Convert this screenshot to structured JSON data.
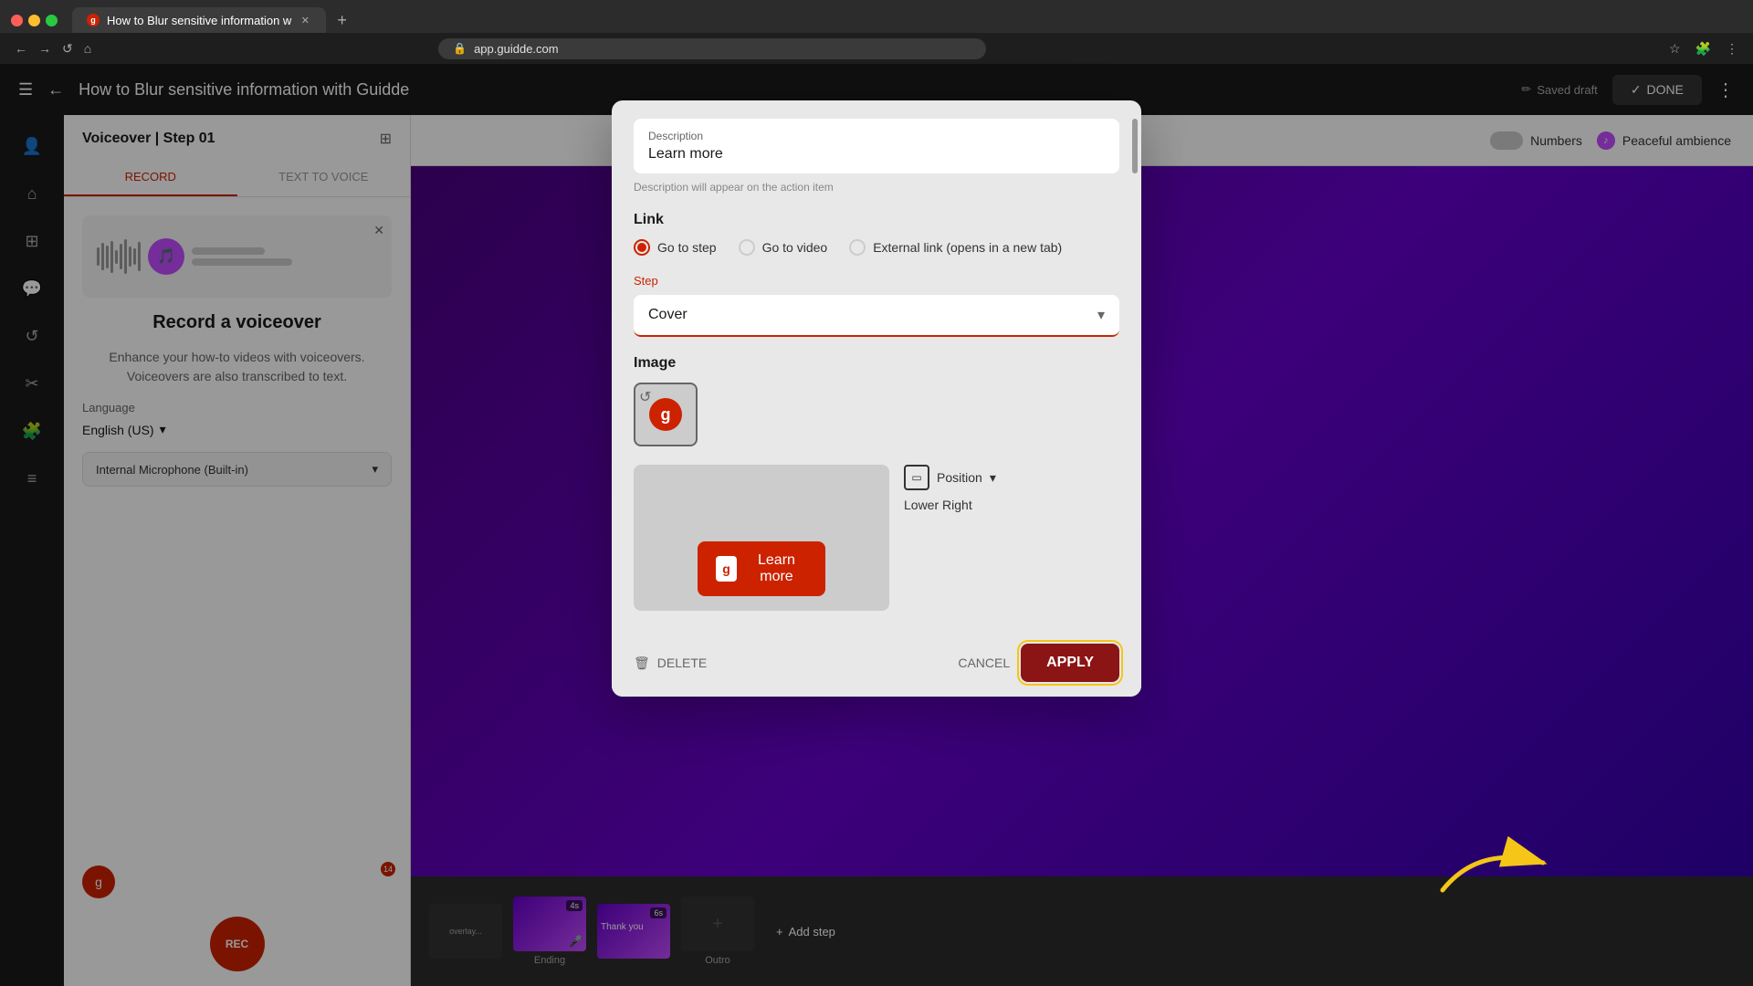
{
  "browser": {
    "tab_title": "How to Blur sensitive information w",
    "url": "app.guidde.com",
    "tab_icon": "g",
    "new_tab_label": "+"
  },
  "header": {
    "menu_icon": "☰",
    "back_icon": "←",
    "title": "How to Blur sensitive information with Guidde",
    "saved_draft": "Saved draft",
    "done_label": "DONE",
    "more_icon": "⋮",
    "pencil_icon": "✏"
  },
  "left_panel": {
    "title": "Voiceover | Step 01",
    "tab_record": "RECORD",
    "tab_text_to_voice": "TEXT TO VOICE",
    "record_title": "Record a voiceover",
    "record_subtitle": "Enhance your how-to videos with voiceovers.\nVoiceovers are also transcribed to text.",
    "language_label": "Language",
    "language_value": "English (US)",
    "microphone_label": "Internal Microphone (Built-in)",
    "rec_label": "REC"
  },
  "right_panel": {
    "numbers_label": "Numbers",
    "music_label": "Peaceful ambience",
    "add_step_label": "Add step"
  },
  "timeline": {
    "items": [
      {
        "label": "Ending",
        "duration": "4s",
        "type": "purple"
      },
      {
        "label": "Thank you",
        "duration": "6s",
        "type": "purple"
      },
      {
        "label": "Outro",
        "type": "add"
      }
    ]
  },
  "dialog": {
    "description_label": "Description",
    "description_value": "Learn more",
    "description_hint": "Description will appear on the action item",
    "link_title": "Link",
    "link_options": [
      {
        "id": "go_to_step",
        "label": "Go to step",
        "selected": true
      },
      {
        "id": "go_to_video",
        "label": "Go to video",
        "selected": false
      },
      {
        "id": "external_link",
        "label": "External link (opens in a new tab)",
        "selected": false
      }
    ],
    "step_label": "Step",
    "step_value": "Cover",
    "image_title": "Image",
    "position_label": "Position",
    "position_value": "Lower Right",
    "preview_btn_label": "Learn more",
    "delete_label": "DELETE",
    "cancel_label": "CANCEL",
    "apply_label": "APPLY",
    "arrow_annotation": true
  },
  "colors": {
    "brand_red": "#cc2200",
    "accent_purple": "#c44bff",
    "apply_bg": "#8b1414",
    "arrow_yellow": "#f5c518"
  },
  "icons": {
    "menu": "☰",
    "back": "←",
    "home": "⌂",
    "layers": "⊞",
    "chat": "💬",
    "refresh": "↺",
    "puzzle": "🧩",
    "list": "≡",
    "user_add": "👤",
    "gear": "⚙",
    "close": "✕",
    "dropdown": "▾",
    "music_note": "♪",
    "mic": "🎤",
    "position_icon": "▭",
    "trash": "🗑"
  }
}
